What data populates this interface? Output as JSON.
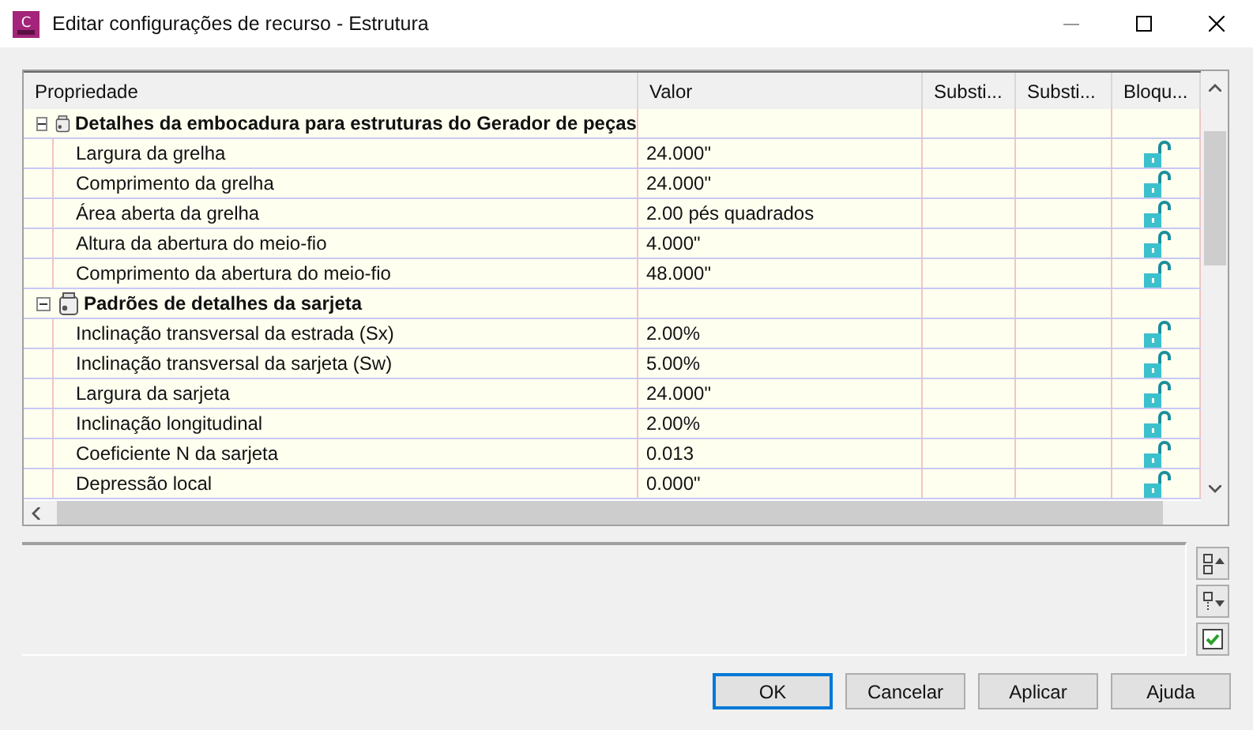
{
  "window": {
    "title": "Editar configurações de recurso - Estrutura",
    "icon_letter": "C"
  },
  "columns": [
    "Propriedade",
    "Valor",
    "Substi...",
    "Substi...",
    "Bloqu..."
  ],
  "groups": [
    {
      "name": "Detalhes da embocadura para estruturas do Gerador de peças",
      "expanded": true,
      "rows": [
        {
          "property": "Largura da grelha",
          "value": "24.000\"",
          "locked": false
        },
        {
          "property": "Comprimento da grelha",
          "value": "24.000\"",
          "locked": false
        },
        {
          "property": "Área aberta da grelha",
          "value": "2.00 pés quadrados",
          "locked": false
        },
        {
          "property": "Altura da abertura do meio-fio",
          "value": "4.000\"",
          "locked": false
        },
        {
          "property": "Comprimento da abertura do meio-fio",
          "value": "48.000\"",
          "locked": false
        }
      ]
    },
    {
      "name": "Padrões de detalhes da sarjeta",
      "expanded": true,
      "rows": [
        {
          "property": "Inclinação transversal da estrada (Sx)",
          "value": "2.00%",
          "locked": false
        },
        {
          "property": "Inclinação transversal da sarjeta (Sw)",
          "value": "5.00%",
          "locked": false
        },
        {
          "property": "Largura da sarjeta",
          "value": "24.000\"",
          "locked": false
        },
        {
          "property": "Inclinação longitudinal",
          "value": "2.00%",
          "locked": false
        },
        {
          "property": "Coeficiente N da sarjeta",
          "value": "0.013",
          "locked": false
        },
        {
          "property": "Depressão local",
          "value": "0.000\"",
          "locked": false
        }
      ]
    }
  ],
  "buttons": [
    "OK",
    "Cancelar",
    "Aplicar",
    "Ajuda"
  ]
}
